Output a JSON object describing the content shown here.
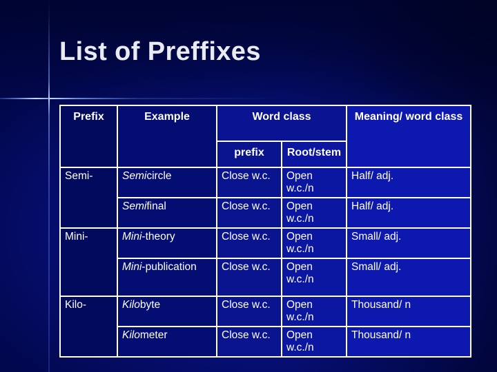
{
  "slide": {
    "title": "List of Preffixes",
    "background_color": "#000a4e",
    "accent_line_color": "#c8e1ff",
    "table_border_color": "#ffffff",
    "text_color": "#ffffff"
  },
  "table": {
    "headers": {
      "prefix": "Prefix",
      "example": "Example",
      "word_class": "Word class",
      "word_class_sub_prefix": "prefix",
      "word_class_sub_root": "Root/stem",
      "meaning": "Meaning/ word class"
    },
    "groups": [
      {
        "prefix": "Semi-",
        "meaning": "Half/ adj.",
        "rows": [
          {
            "example_italic": "Semi",
            "example_rest": "circle",
            "word_class_prefix": "Close w.c.",
            "word_class_root": "Open w.c./n",
            "meaning": "Half/ adj."
          },
          {
            "example_italic": "Semi",
            "example_rest": "final",
            "word_class_prefix": "Close w.c.",
            "word_class_root": "Open w.c./n",
            "meaning": "Half/ adj."
          }
        ]
      },
      {
        "prefix": "Mini-",
        "meaning": "Small/ adj.",
        "rows": [
          {
            "example_italic": "Mini",
            "example_rest": "-theory",
            "word_class_prefix": "Close w.c.",
            "word_class_root": "Open w.c./n",
            "meaning": "Small/ adj."
          },
          {
            "example_italic": "Mini",
            "example_rest": "-publication",
            "word_class_prefix": "Close w.c.",
            "word_class_root": "Open w.c./n",
            "meaning": "Small/ adj."
          }
        ]
      },
      {
        "prefix": "Kilo-",
        "meaning": "Thousand/ n",
        "rows": [
          {
            "example_italic": "Kilo",
            "example_rest": "byte",
            "word_class_prefix": "Close w.c.",
            "word_class_root": "Open w.c./n",
            "meaning": "Thousand/ n"
          },
          {
            "example_italic": "Kilo",
            "example_rest": "meter",
            "word_class_prefix": "Close w.c.",
            "word_class_root": "Open w.c./n",
            "meaning": "Thousand/ n"
          }
        ]
      }
    ]
  }
}
